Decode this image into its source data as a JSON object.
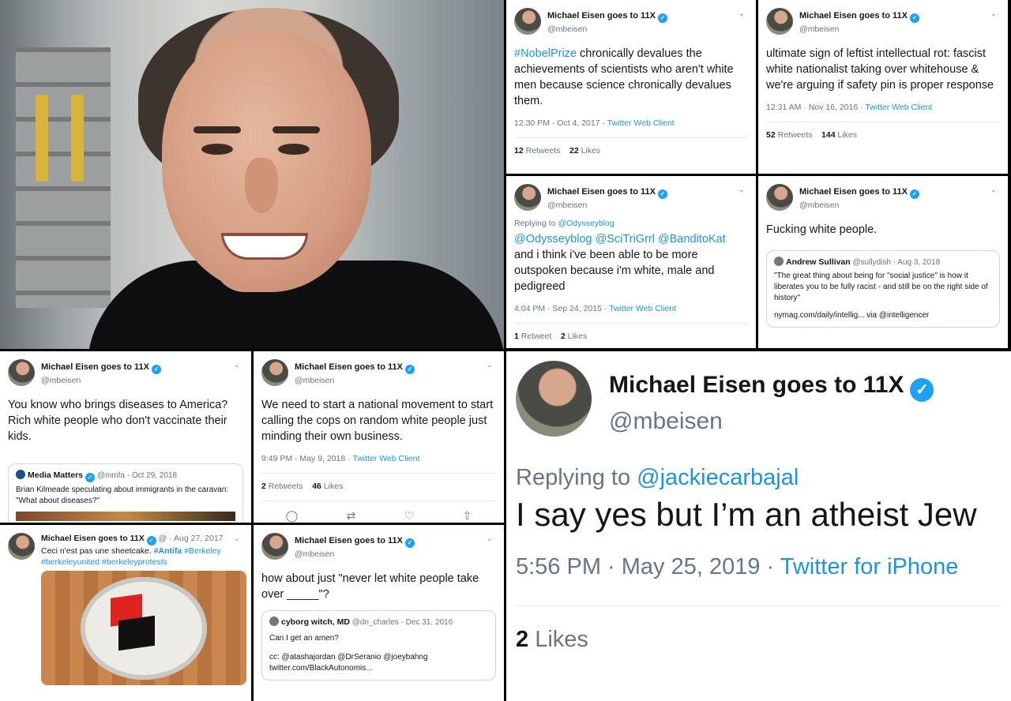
{
  "user": {
    "name": "Michael Eisen goes to 11X",
    "handle": "@mbeisen"
  },
  "icons": {
    "verified": "verified-badge-icon",
    "caret": "chevron-down-icon",
    "reply": "reply-icon",
    "retweet": "retweet-icon",
    "like": "heart-icon",
    "share": "share-icon"
  },
  "colors": {
    "link": "#1b95e0",
    "verified": "#1da1f2"
  },
  "tweets": {
    "nobel": {
      "text_hashtag": "#NobelPrize",
      "text_rest": " chronically devalues the achievements of scientists who aren't white men because science chronically devalues them.",
      "time": "12:30 PM · Oct 4, 2017 · ",
      "client": "Twitter Web Client",
      "retweets": "12",
      "retweets_label": " Retweets",
      "likes": "22",
      "likes_label": " Likes"
    },
    "rot": {
      "text": "ultimate sign of leftist intellectual rot: fascist white nationalist taking over whitehouse & we're arguing if safety pin is proper response",
      "time": "12:31 AM · Nov 16, 2016 · ",
      "client": "Twitter Web Client",
      "retweets": "52",
      "retweets_label": " Retweets",
      "likes": "144",
      "likes_label": " Likes"
    },
    "odyssey": {
      "reply_prefix": "Replying to ",
      "reply_to": "@Odysseyblog",
      "mentions": "@Odysseyblog @SciTriGrrl @BanditoKat",
      "text": "and i think i've been able to be more outspoken because i'm white, male and pedigreed",
      "time": "4:04 PM · Sep 24, 2015 · ",
      "client": "Twitter Web Client",
      "retweets": "1",
      "retweets_label": " Retweet",
      "likes": "2",
      "likes_label": " Likes"
    },
    "fwp": {
      "text": "Fucking white people.",
      "quote_name": "Andrew Sullivan",
      "quote_handle": "@sullydish · Aug 3, 2018",
      "quote_text": "\"The great thing about being for \"social justice\" is how it liberates you to be fully racist - and still be on the right side of history\"",
      "quote_link": "nymag.com/daily/intellig... via @intelligencer"
    },
    "diseases": {
      "text": "You know who brings diseases to America? Rich white people who don't vaccinate their kids.",
      "quote_name": "Media Matters",
      "quote_handle": "@mmfa · Oct 29, 2018",
      "quote_text": "Brian Kilmeade speculating about immigrants in the caravan: \"What about diseases?\""
    },
    "cops": {
      "text": "We need to start a national movement to start calling the cops on random white people just minding their own business.",
      "time": "9:49 PM · May 9, 2018 · ",
      "client": "Twitter Web Client",
      "retweets": "2",
      "retweets_label": " Retweets",
      "likes": "46",
      "likes_label": " Likes"
    },
    "cake": {
      "handle_time": "@ · Aug 27, 2017",
      "text_plain": "Ceci n'est pas une sheetcake. ",
      "text_antifa": "#Antifa",
      "text_tags": " #Berkeley #berkeleyunited #berkeleyprotests"
    },
    "never": {
      "text": "how about just \"never let white people take over _____\"?",
      "quote_name": "cyborg witch, MD",
      "quote_handle": "@dn_charles · Dec 31, 2016",
      "quote_text": "Can I get an amen?",
      "quote_cc": "cc: @atashajordan @DrSeranio @joeybahng twitter.com/BlackAutonomis..."
    },
    "atheist": {
      "reply_prefix": "Replying to ",
      "reply_to": "@jackiecarbajal",
      "text": "I say yes but I’m an atheist Jew",
      "time": "5:56 PM · May 25, 2019 · ",
      "client": "Twitter for iPhone",
      "likes": "2",
      "likes_label": " Likes"
    }
  }
}
